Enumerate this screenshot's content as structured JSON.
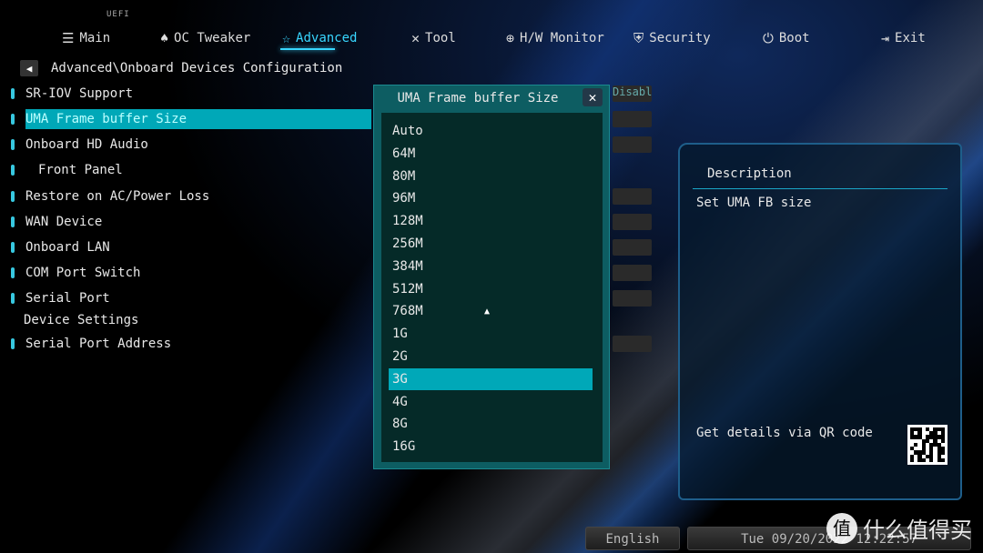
{
  "header": {
    "brand": "UEFI"
  },
  "nav": [
    {
      "label": "Main",
      "icon": "list-icon"
    },
    {
      "label": "OC Tweaker",
      "icon": "rocket-icon"
    },
    {
      "label": "Advanced",
      "icon": "star-icon",
      "active": true
    },
    {
      "label": "Tool",
      "icon": "tools-icon"
    },
    {
      "label": "H/W Monitor",
      "icon": "crosshair-icon"
    },
    {
      "label": "Security",
      "icon": "shield-icon"
    },
    {
      "label": "Boot",
      "icon": "power-icon"
    },
    {
      "label": "Exit",
      "icon": "exit-door-icon"
    }
  ],
  "breadcrumb": "Advanced\\Onboard Devices Configuration",
  "settings": [
    {
      "label": "SR-IOV Support",
      "value": "Disabled"
    },
    {
      "label": "UMA Frame buffer Size",
      "selected": true
    },
    {
      "label": "Onboard HD Audio"
    },
    {
      "label": "Front Panel"
    },
    {
      "label": "Restore on AC/Power Loss"
    },
    {
      "label": "WAN Device"
    },
    {
      "label": "Onboard LAN"
    },
    {
      "label": "COM Port Switch"
    },
    {
      "label": "Serial Port"
    },
    {
      "label": "Device Settings"
    },
    {
      "label": "Serial Port Address"
    }
  ],
  "popup": {
    "title": "UMA Frame buffer Size",
    "options": [
      "Auto",
      "64M",
      "80M",
      "96M",
      "128M",
      "256M",
      "384M",
      "512M",
      "768M",
      "1G",
      "2G",
      "3G",
      "4G",
      "8G",
      "16G"
    ],
    "selected": "3G"
  },
  "description": {
    "heading": "Description",
    "text": "Set UMA FB size",
    "qr_text": "Get details via QR code"
  },
  "footer": {
    "language": "English",
    "datetime": "Tue 09/20/2022 12:22:57"
  },
  "watermark": {
    "badge": "值",
    "text": "什么值得买"
  },
  "colors": {
    "accent": "#38d6ff",
    "selected": "#00a8b8",
    "popup": "#0d5d62"
  }
}
